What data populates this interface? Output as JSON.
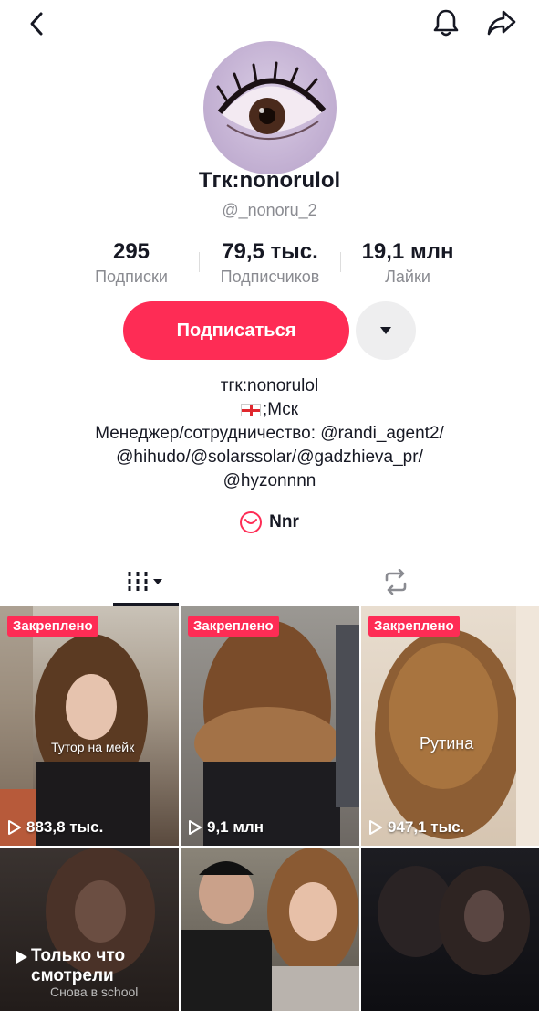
{
  "header": {
    "back_icon": "chevron-left-icon",
    "notification_icon": "bell-icon",
    "share_icon": "share-arrow-icon"
  },
  "profile": {
    "display_name": "Тгк:nonorulol",
    "username": "@_nonoru_2"
  },
  "stats": [
    {
      "value": "295",
      "label": "Подписки"
    },
    {
      "value": "79,5 тыс.",
      "label": "Подписчиков"
    },
    {
      "value": "19,1 млн",
      "label": "Лайки"
    }
  ],
  "actions": {
    "follow_label": "Подписаться",
    "more_icon": "caret-down-icon"
  },
  "bio": {
    "line1": "тгк:nonorulol",
    "line2": ";Мск",
    "line3": "Менеджер/сотрудничество: @randi_agent2/",
    "line4": "@hihudo/@solarssolar/@gadzhieva_pr/",
    "line5": "@hyzonnnn"
  },
  "link": {
    "label": "Nnr"
  },
  "tabs": {
    "videos_icon": "grid-videos-icon",
    "reposts_icon": "repost-icon"
  },
  "videos": [
    {
      "pinned": "Закреплено",
      "views": "883,8 тыс.",
      "caption": "Тутор на мейк"
    },
    {
      "pinned": "Закреплено",
      "views": "9,1 млн",
      "caption": ""
    },
    {
      "pinned": "Закреплено",
      "views": "947,1 тыс.",
      "caption": "Рутина"
    }
  ],
  "watched": {
    "label_line1": "Только что",
    "label_line2": "смотрели",
    "sub": "Снова в school"
  },
  "colors": {
    "accent": "#fe2c55",
    "text": "#161823",
    "muted": "#8a8b91"
  }
}
